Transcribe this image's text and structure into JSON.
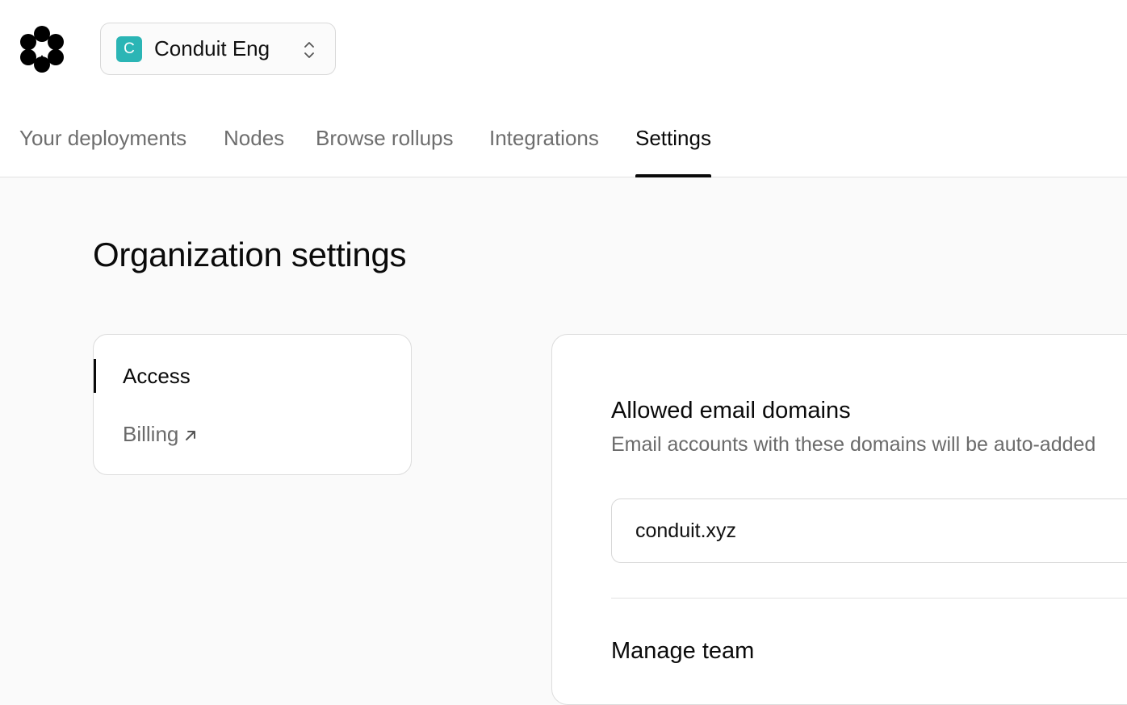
{
  "org_switcher": {
    "avatar_letter": "C",
    "name": "Conduit Eng",
    "avatar_color": "#2bb5b5"
  },
  "tabs": [
    {
      "label": "Your deployments",
      "active": false
    },
    {
      "label": "Nodes",
      "active": false
    },
    {
      "label": "Browse rollups",
      "active": false
    },
    {
      "label": "Integrations",
      "active": false
    },
    {
      "label": "Settings",
      "active": true
    }
  ],
  "page": {
    "title": "Organization settings"
  },
  "side_nav": {
    "items": [
      {
        "label": "Access",
        "active": true
      },
      {
        "label": "Billing",
        "external": true
      }
    ]
  },
  "allowed_domains": {
    "title": "Allowed email domains",
    "description": "Email accounts with these domains will be auto-added",
    "value": "conduit.xyz"
  },
  "manage_team": {
    "title": "Manage team"
  },
  "icons": {
    "logo": "petal-logo-icon",
    "switcher": "chevron-up-down-icon",
    "billing": "arrow-up-right-icon"
  }
}
